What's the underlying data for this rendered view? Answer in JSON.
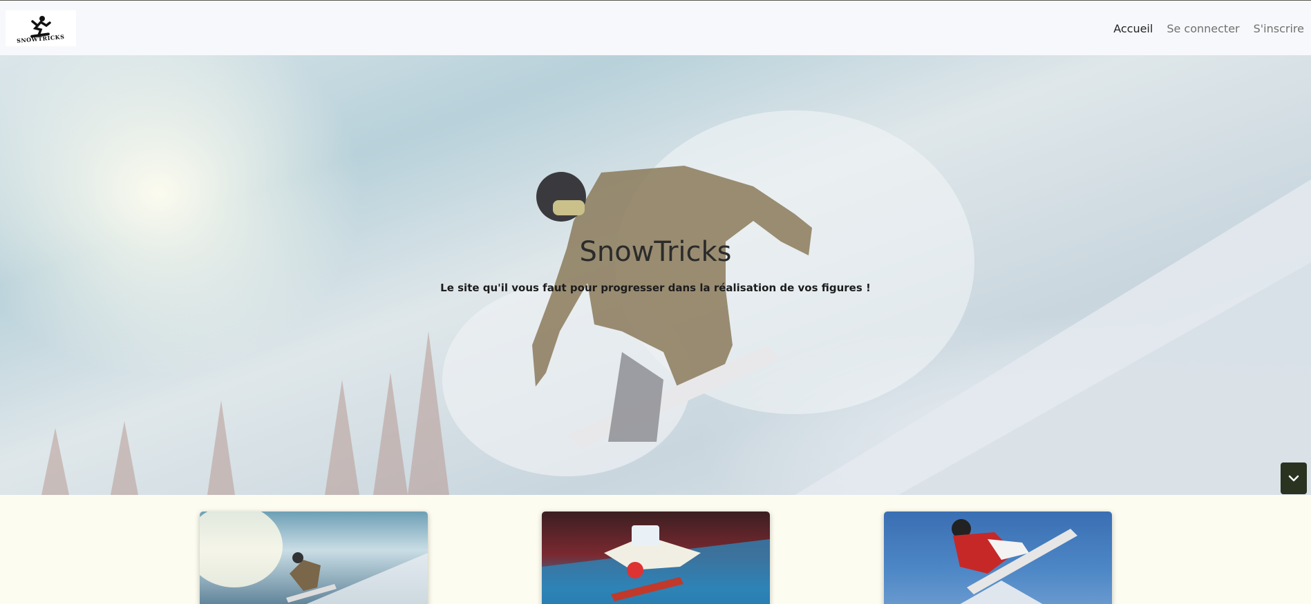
{
  "nav": {
    "logo_alt": "SNOWTRICKS",
    "links": [
      {
        "label": "Accueil",
        "active": true
      },
      {
        "label": "Se connecter",
        "active": false
      },
      {
        "label": "S'inscrire",
        "active": false
      }
    ]
  },
  "hero": {
    "title": "SnowTricks",
    "subtitle": "Le site qu'il vous faut pour progresser dans la réalisation de vos figures !",
    "scroll_icon": "chevron-down-icon"
  },
  "colors": {
    "page_bg": "#fdfcf0",
    "navbar_bg": "#f7f8fb",
    "scroll_button_bg": "#2a3320"
  },
  "cards": [
    {
      "image": "snowboarder-jumping-image"
    },
    {
      "image": "olympic-snowboarder-image"
    },
    {
      "image": "snowboarder-red-jacket-image"
    }
  ]
}
